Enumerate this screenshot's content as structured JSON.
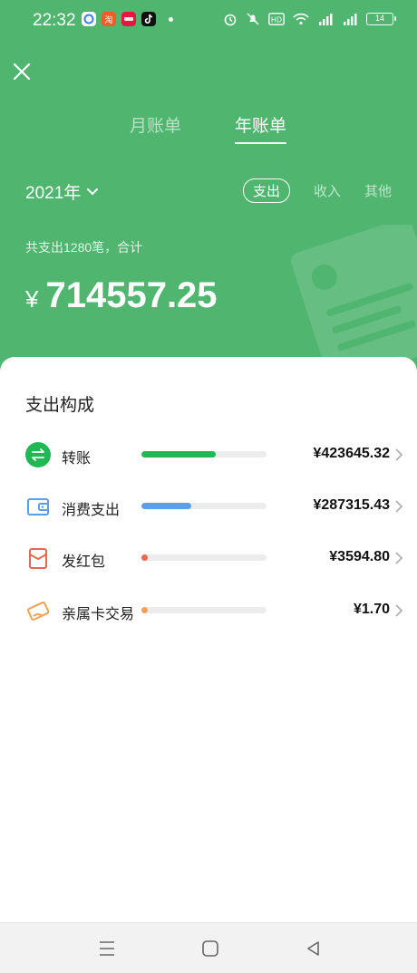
{
  "status_bar": {
    "time": "22:32",
    "battery": "14",
    "app_icons": [
      "quark-icon",
      "taobao-icon",
      "weibo-icon",
      "douyin-icon"
    ],
    "system_icons": [
      "alarm-icon",
      "mute-icon",
      "hd-icon",
      "wifi-icon",
      "5g-signal-icon",
      "5g-signal-icon"
    ]
  },
  "header": {
    "tabs": [
      {
        "label": "月账单",
        "active": false
      },
      {
        "label": "年账单",
        "active": true
      }
    ],
    "year_selector": "2021年",
    "filters": [
      {
        "label": "支出",
        "active": true
      },
      {
        "label": "收入",
        "active": false
      },
      {
        "label": "其他",
        "active": false
      }
    ],
    "summary_text": "共支出1280笔，合计",
    "currency_symbol": "¥",
    "total_amount": "714557.25",
    "accent_color": "#4fb56f"
  },
  "composition": {
    "title": "支出构成",
    "items": [
      {
        "name": "转账",
        "amount": "¥423645.32",
        "share": 0.593,
        "color": "#1fb855",
        "icon": "transfer-icon"
      },
      {
        "name": "消费支出",
        "amount": "¥287315.43",
        "share": 0.402,
        "color": "#5c9ee8",
        "icon": "wallet-icon"
      },
      {
        "name": "发红包",
        "amount": "¥3594.80",
        "share": 0.005,
        "color": "#e8674f",
        "icon": "red-packet-icon"
      },
      {
        "name": "亲属卡交易",
        "amount": "¥1.70",
        "share": 0.0001,
        "color": "#f2a15a",
        "icon": "family-card-icon"
      }
    ]
  },
  "nav_bar": {
    "buttons": [
      "menu-icon",
      "home-icon",
      "back-icon"
    ]
  }
}
